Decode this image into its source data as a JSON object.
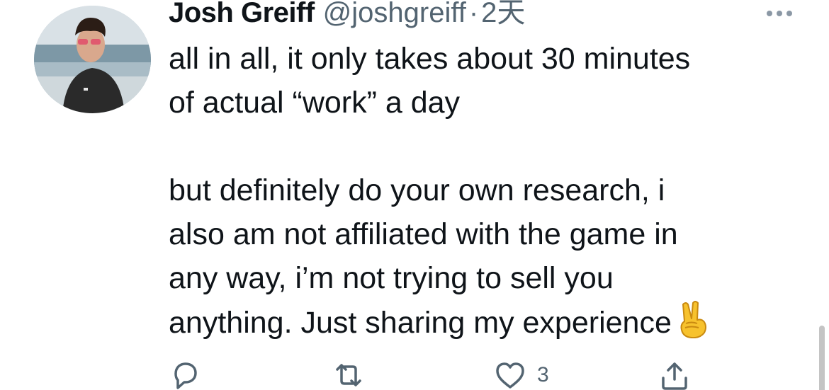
{
  "tweet": {
    "author": {
      "display_name": "Josh Greiff",
      "handle": "@joshgreiff",
      "avatar_icon": "profile-photo"
    },
    "separator": "·",
    "time": "2天",
    "text_lines": [
      "all in all, it only takes about 30 minutes",
      "of actual “work” a day",
      "",
      "but definitely do your own research, i",
      "also am not affiliated with the game in",
      "any way, i’m not trying to sell you",
      "anything. Just sharing my experience"
    ],
    "emoji": "victory-hand-emoji",
    "actions": {
      "reply": {
        "icon": "reply-icon",
        "count": ""
      },
      "retweet": {
        "icon": "retweet-icon",
        "count": ""
      },
      "like": {
        "icon": "heart-icon",
        "count": "3"
      },
      "share": {
        "icon": "share-icon",
        "count": ""
      }
    },
    "more_icon": "more-options-icon"
  },
  "colors": {
    "text_primary": "#0f1419",
    "text_secondary": "#536471",
    "background": "#ffffff"
  }
}
